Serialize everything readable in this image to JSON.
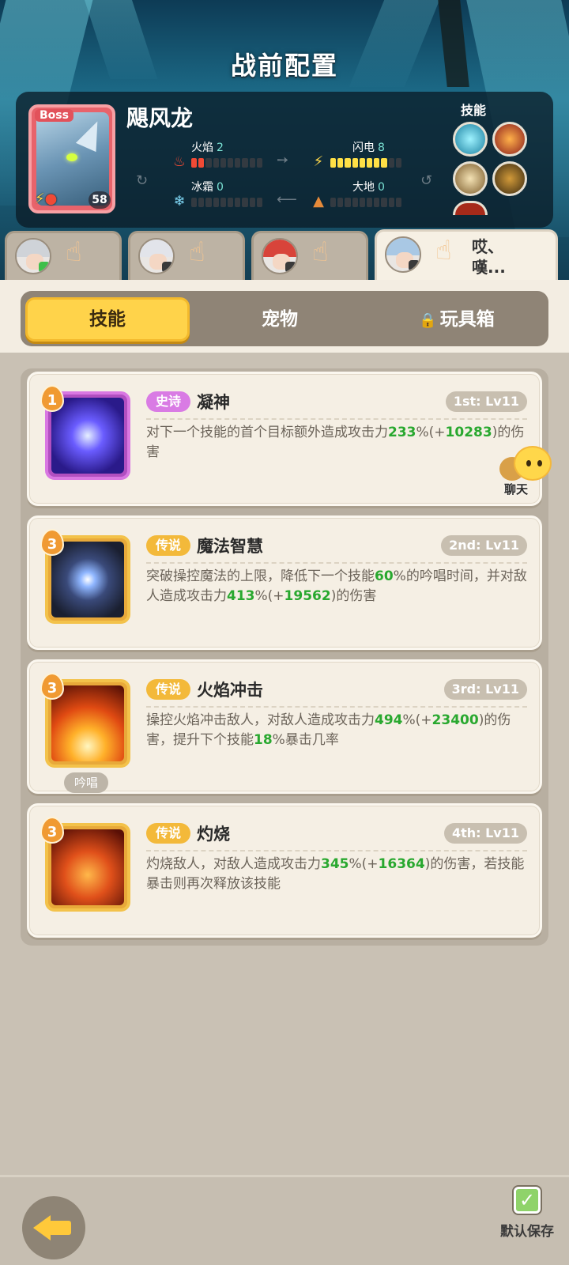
{
  "header": {
    "title": "战前配置"
  },
  "boss": {
    "badge": "Boss",
    "name": "飓风龙",
    "level": "58",
    "stats": [
      {
        "label": "火焰",
        "value": "2",
        "level": 2,
        "max": 10
      },
      {
        "label": "闪电",
        "value": "8",
        "level": 8,
        "max": 10
      },
      {
        "label": "冰霜",
        "value": "0",
        "level": 0,
        "max": 10
      },
      {
        "label": "大地",
        "value": "0",
        "level": 0,
        "max": 10
      }
    ],
    "skills_label": "技能"
  },
  "heroes": {
    "active_message": "哎、嘆..."
  },
  "category_tabs": {
    "skills": "技能",
    "pets": "宠物",
    "toybox": "玩具箱"
  },
  "skill_cards": [
    {
      "level": "1",
      "rarity": "史诗",
      "name": "凝神",
      "order": "1st: Lv11",
      "desc": [
        {
          "t": "对下一个技能的首个目标额外造成攻击力"
        },
        {
          "t": "233",
          "g": true
        },
        {
          "t": "%(+"
        },
        {
          "t": "10283",
          "g": true
        },
        {
          "t": ")的伤害"
        }
      ]
    },
    {
      "level": "3",
      "rarity": "传说",
      "name": "魔法智慧",
      "order": "2nd: Lv11",
      "desc": [
        {
          "t": "突破操控魔法的上限，降低下一个技能"
        },
        {
          "t": "60",
          "g": true
        },
        {
          "t": "%的吟唱时间，并对敌人造成攻击力"
        },
        {
          "t": "413",
          "g": true
        },
        {
          "t": "%(+"
        },
        {
          "t": "19562",
          "g": true
        },
        {
          "t": ")的伤害"
        }
      ]
    },
    {
      "level": "3",
      "rarity": "传说",
      "name": "火焰冲击",
      "order": "3rd: Lv11",
      "chant": "吟唱",
      "desc": [
        {
          "t": "操控火焰冲击敌人，对敌人造成攻击力"
        },
        {
          "t": "494",
          "g": true
        },
        {
          "t": "%(+"
        },
        {
          "t": "23400",
          "g": true
        },
        {
          "t": ")的伤害，提升下个技能"
        },
        {
          "t": "18",
          "g": true
        },
        {
          "t": "%暴击几率"
        }
      ]
    },
    {
      "level": "3",
      "rarity": "传说",
      "name": "灼烧",
      "order": "4th: Lv11",
      "desc": [
        {
          "t": "灼烧敌人，对敌人造成攻击力"
        },
        {
          "t": "345",
          "g": true
        },
        {
          "t": "%(+"
        },
        {
          "t": "16364",
          "g": true
        },
        {
          "t": ")的伤害，若技能暴击则再次释放该技能"
        }
      ]
    }
  ],
  "chat": {
    "label": "聊天"
  },
  "bottom": {
    "save_label": "默认保存"
  },
  "colors": {
    "epic": "#d97be4",
    "legend": "#f3b93a",
    "highlight": "#29a82f",
    "active_tab": "#ffd34a"
  },
  "icons": [
    "fire-icon",
    "lightning-icon",
    "snowflake-icon",
    "earth-icon",
    "lock-icon",
    "hand-tap-icon",
    "back-arrow-icon",
    "checkbox-icon",
    "chat-bubble-icon"
  ]
}
